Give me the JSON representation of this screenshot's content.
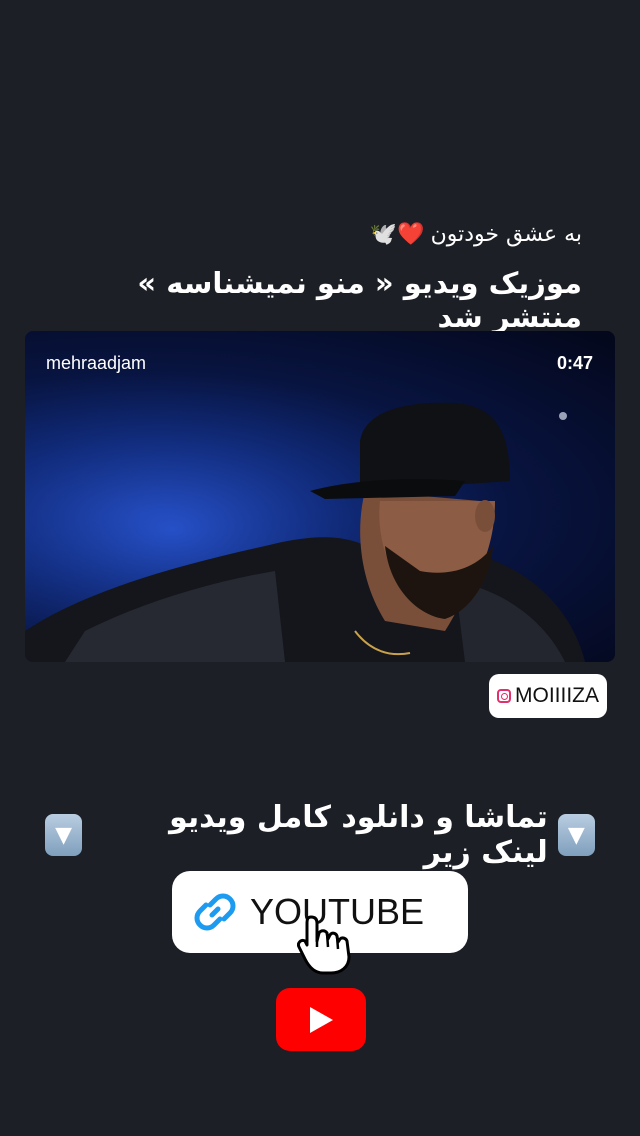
{
  "story": {
    "caption_small": "به عشق خودتون",
    "caption_emojis": "❤️🕊️",
    "caption_big": "موزیک ویدیو « منو نمیشناسه » منتشر شد"
  },
  "video": {
    "username": "mehraadjam",
    "duration": "0:47"
  },
  "mention": {
    "handle": "MOIIIIZA",
    "icon": "instagram-icon"
  },
  "cta": {
    "text": "تماشا و دانلود کامل ویدیو لینک زیر",
    "arrow_icon": "down-arrow-box-icon"
  },
  "link_sticker": {
    "label": "YOUTUBE",
    "icon": "link-icon",
    "color": "#1d9bf0"
  },
  "youtube_logo": {
    "icon": "youtube-play-icon",
    "color": "#ff0000"
  }
}
